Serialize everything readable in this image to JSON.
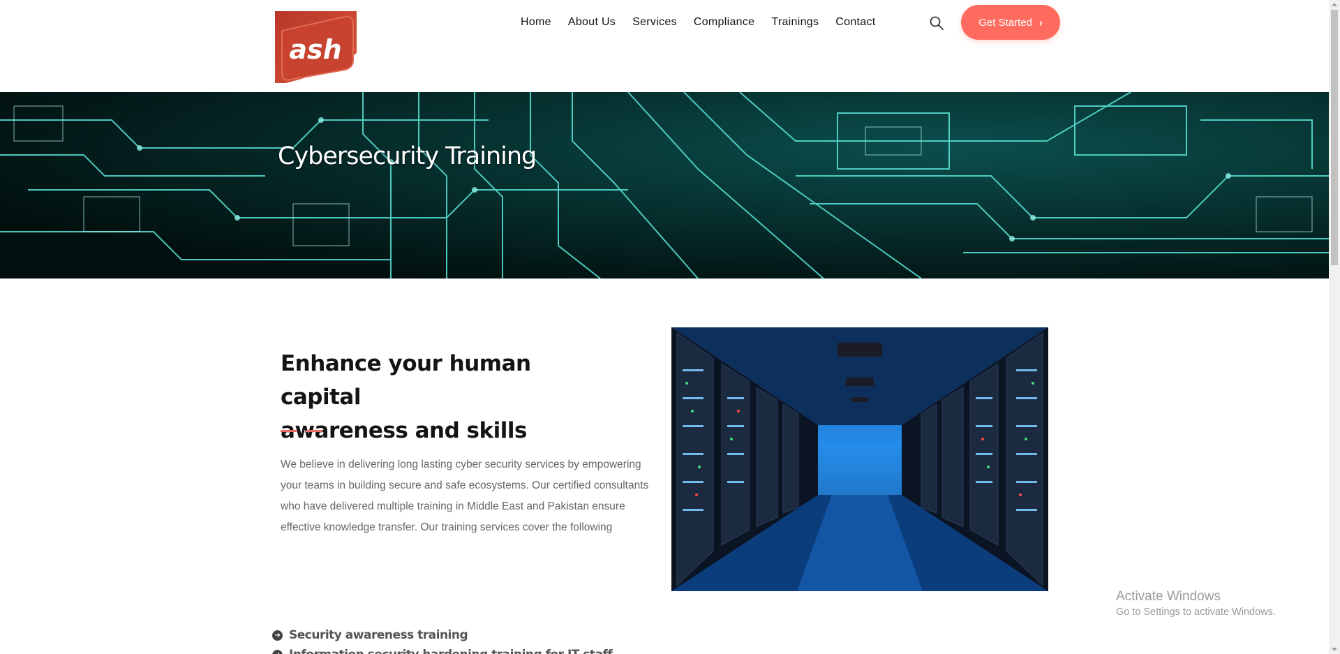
{
  "brand": {
    "logo_text": "ash",
    "logo_color": "#c8432f"
  },
  "nav": {
    "items": [
      "Home",
      "About Us",
      "Services",
      "Compliance",
      "Trainings",
      "Contact"
    ]
  },
  "header": {
    "search_icon": "search-icon",
    "cta_label": "Get Started",
    "cta_color": "#ff6b5e"
  },
  "banner": {
    "title": "Cybersecurity Training"
  },
  "content": {
    "heading_line1": "Enhance your human capital",
    "heading_line2": "awareness and skills",
    "accent_color": "#ef6a64",
    "paragraph": "We believe in delivering long lasting cyber security services by empowering your teams in building secure and safe ecosystems. Our certified consultants who have delivered multiple training in Middle East and Pakistan ensure effective knowledge transfer. Our training services cover the following",
    "list": [
      "Security awareness training",
      "Information security hardening training for IT staff"
    ]
  },
  "overlay": {
    "activate_title": "Activate Windows",
    "activate_sub": "Go to Settings to activate Windows."
  }
}
